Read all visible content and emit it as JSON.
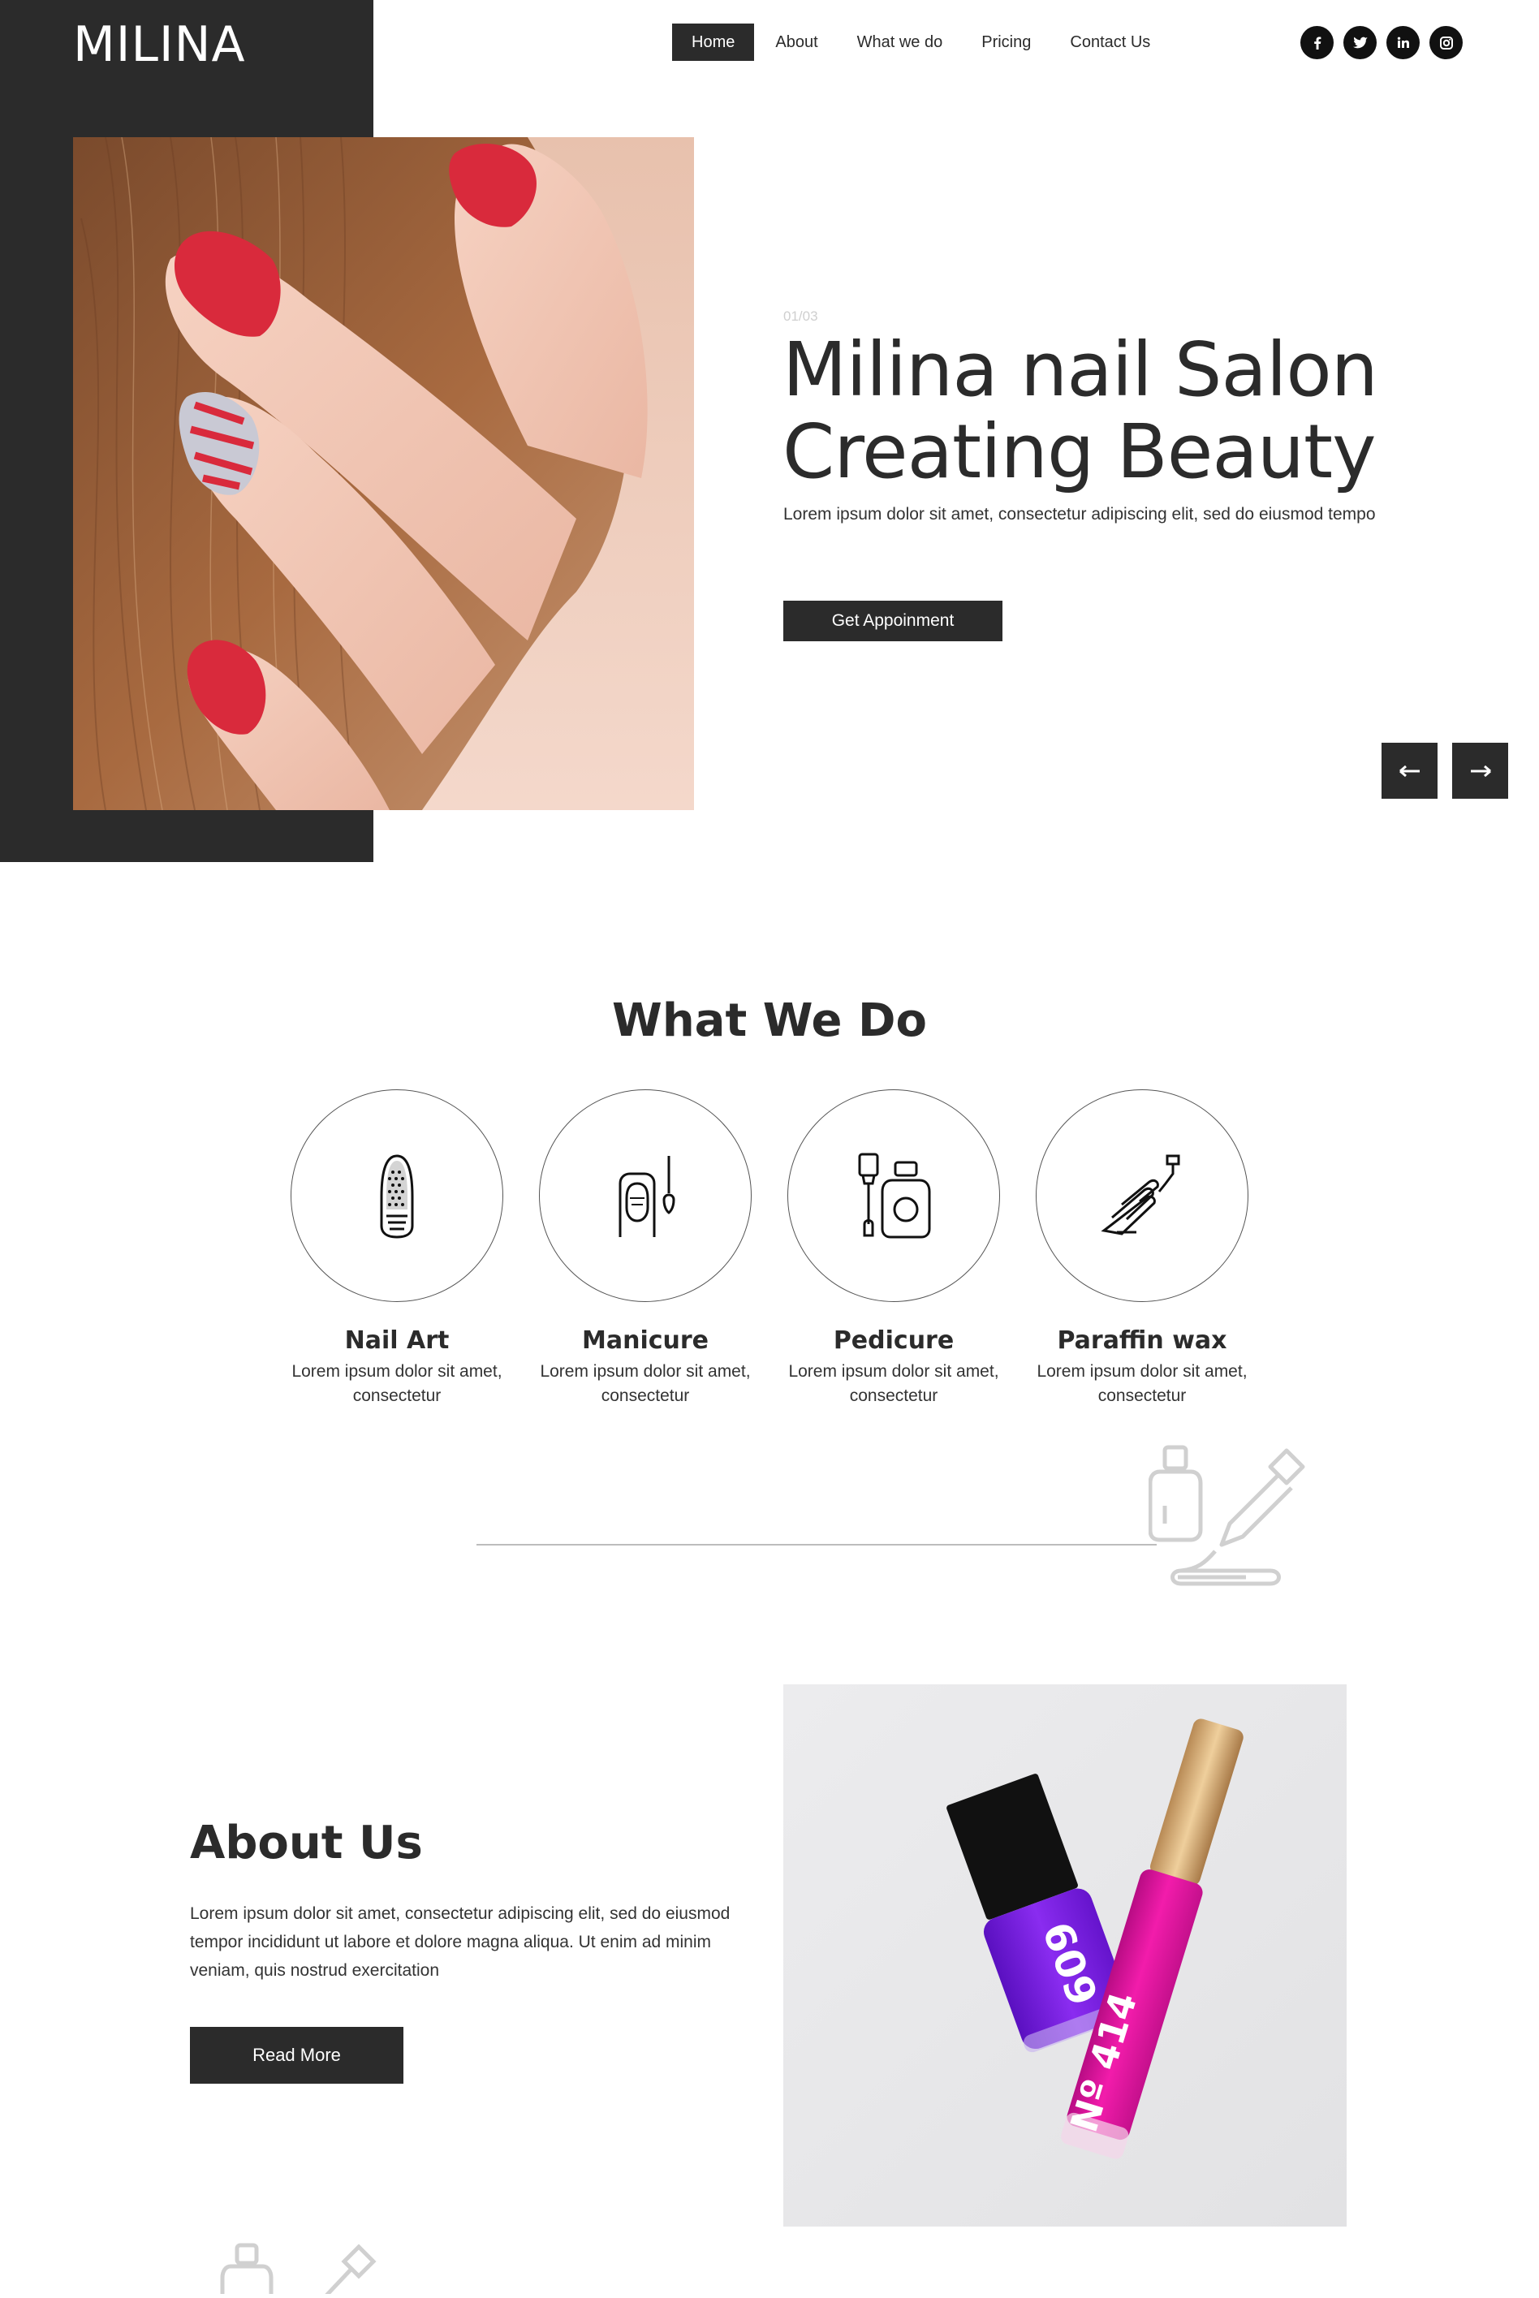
{
  "brand": {
    "logo": "MILINA"
  },
  "nav": {
    "items": [
      {
        "label": "Home",
        "active": true
      },
      {
        "label": "About",
        "active": false
      },
      {
        "label": "What we do",
        "active": false
      },
      {
        "label": "Pricing",
        "active": false
      },
      {
        "label": "Contact Us",
        "active": false
      }
    ]
  },
  "social": [
    "facebook-icon",
    "twitter-icon",
    "linkedin-icon",
    "instagram-icon"
  ],
  "hero": {
    "counter": "01/03",
    "title_line1": "Milina nail Salon",
    "title_line2": "Creating Beauty",
    "subtitle": "Lorem ipsum dolor sit amet, consectetur adipiscing elit, sed do eiusmod tempo",
    "cta_label": "Get Appoinment"
  },
  "services": {
    "title": "What We Do",
    "items": [
      {
        "name": "Nail Art",
        "desc": "Lorem ipsum dolor sit amet, consectetur",
        "icon": "nail-art-icon"
      },
      {
        "name": "Manicure",
        "desc": "Lorem ipsum dolor sit amet, consectetur",
        "icon": "manicure-icon"
      },
      {
        "name": "Pedicure",
        "desc": "Lorem ipsum dolor sit amet, consectetur",
        "icon": "pedicure-icon"
      },
      {
        "name": "Paraffin wax",
        "desc": "Lorem ipsum dolor sit amet, consectetur",
        "icon": "paraffin-wax-icon"
      }
    ]
  },
  "about": {
    "title": "About Us",
    "text": "Lorem ipsum dolor sit amet, consectetur adipiscing elit, sed do eiusmod tempor incididunt ut labore et dolore magna aliqua. Ut enim ad minim veniam, quis nostrud exercitation",
    "button_label": "Read More",
    "bottle_labels": [
      "609",
      "Nº 414"
    ]
  },
  "colors": {
    "dark": "#2b2b2b",
    "polish_red": "#d92a3c",
    "polish_purple": "#7a22e0",
    "polish_magenta": "#e0149a"
  }
}
